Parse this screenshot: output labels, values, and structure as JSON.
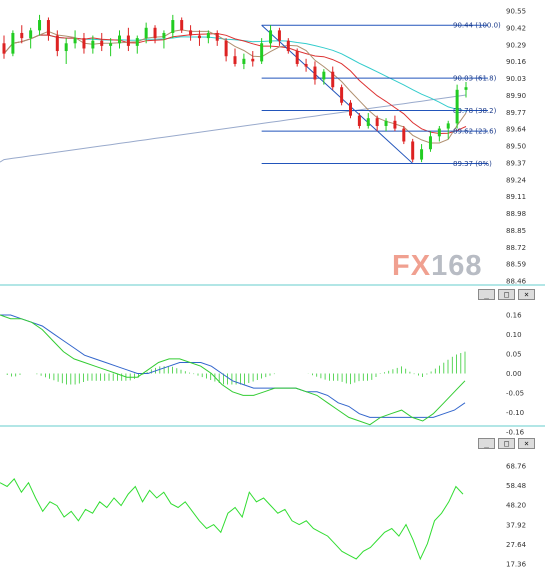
{
  "watermark": {
    "part1": "FX",
    "part2": "168"
  },
  "colors": {
    "up_candle": "#22cc22",
    "down_candle": "#dd2222",
    "fast_ma": "#b09070",
    "mid_ma": "#dd3333",
    "slow_ma": "#33cccc",
    "long_ma": "#99aacc",
    "fib_line": "#2255bb",
    "trend_line": "#2255bb",
    "macd_line": "#33cc33",
    "signal_line": "#3366cc",
    "hist": "#33cc33",
    "rsi_line": "#33dd33",
    "panel_border": "#66cccc"
  },
  "panes": {
    "macd_buttons": [
      "_",
      "□",
      "×"
    ],
    "rsi_buttons": [
      "_",
      "□",
      "×"
    ]
  },
  "chart_data": [
    {
      "type": "candlestick",
      "title": "",
      "ylim": [
        89.4,
        90.55
      ],
      "y_ticks": [
        "90.55",
        "90.42",
        "90.29",
        "90.16",
        "90.03",
        "89.90",
        "89.77",
        "89.64",
        "89.50",
        "89.37",
        "89.24",
        "89.11",
        "88.98",
        "88.85",
        "88.72",
        "88.59",
        "88.46"
      ],
      "fibonacci": [
        {
          "label": "90.44 (100.0)",
          "value": 90.44
        },
        {
          "label": "90.03 (61.8)",
          "value": 90.03
        },
        {
          "label": "89.78 (38.2)",
          "value": 89.78
        },
        {
          "label": "89.62 (23.6)",
          "value": 89.62
        },
        {
          "label": "89.37 (0%)",
          "value": 89.37
        }
      ],
      "candles": [
        [
          90.3,
          90.36,
          90.18,
          90.22
        ],
        [
          90.22,
          90.4,
          90.2,
          90.38
        ],
        [
          90.38,
          90.44,
          90.3,
          90.34
        ],
        [
          90.34,
          90.42,
          90.26,
          90.4
        ],
        [
          90.4,
          90.52,
          90.36,
          90.48
        ],
        [
          90.48,
          90.5,
          90.32,
          90.36
        ],
        [
          90.36,
          90.4,
          90.2,
          90.24
        ],
        [
          90.24,
          90.34,
          90.14,
          90.3
        ],
        [
          90.3,
          90.4,
          90.26,
          90.34
        ],
        [
          90.34,
          90.38,
          90.22,
          90.26
        ],
        [
          90.26,
          90.36,
          90.22,
          90.32
        ],
        [
          90.32,
          90.38,
          90.24,
          90.28
        ],
        [
          90.28,
          90.34,
          90.2,
          90.3
        ],
        [
          90.3,
          90.4,
          90.26,
          90.36
        ],
        [
          90.36,
          90.42,
          90.24,
          90.28
        ],
        [
          90.28,
          90.36,
          90.22,
          90.34
        ],
        [
          90.34,
          90.46,
          90.3,
          90.42
        ],
        [
          90.42,
          90.44,
          90.3,
          90.34
        ],
        [
          90.34,
          90.4,
          90.26,
          90.38
        ],
        [
          90.38,
          90.52,
          90.34,
          90.48
        ],
        [
          90.48,
          90.5,
          90.38,
          90.4
        ],
        [
          90.4,
          90.44,
          90.32,
          90.36
        ],
        [
          90.36,
          90.4,
          90.28,
          90.34
        ],
        [
          90.34,
          90.4,
          90.3,
          90.38
        ],
        [
          90.38,
          90.4,
          90.28,
          90.32
        ],
        [
          90.32,
          90.34,
          90.16,
          90.2
        ],
        [
          90.2,
          90.26,
          90.12,
          90.14
        ],
        [
          90.14,
          90.22,
          90.1,
          90.18
        ],
        [
          90.18,
          90.24,
          90.12,
          90.16
        ],
        [
          90.16,
          90.34,
          90.14,
          90.3
        ],
        [
          90.3,
          90.44,
          90.26,
          90.4
        ],
        [
          90.4,
          90.42,
          90.28,
          90.32
        ],
        [
          90.32,
          90.34,
          90.22,
          90.24
        ],
        [
          90.24,
          90.26,
          90.12,
          90.14
        ],
        [
          90.14,
          90.18,
          90.08,
          90.12
        ],
        [
          90.12,
          90.16,
          89.98,
          90.02
        ],
        [
          90.02,
          90.1,
          89.98,
          90.08
        ],
        [
          90.08,
          90.12,
          89.94,
          89.96
        ],
        [
          89.96,
          89.98,
          89.82,
          89.84
        ],
        [
          89.84,
          89.86,
          89.72,
          89.74
        ],
        [
          89.74,
          89.76,
          89.64,
          89.66
        ],
        [
          89.66,
          89.76,
          89.64,
          89.72
        ],
        [
          89.72,
          89.74,
          89.62,
          89.66
        ],
        [
          89.66,
          89.72,
          89.62,
          89.7
        ],
        [
          89.7,
          89.74,
          89.62,
          89.64
        ],
        [
          89.64,
          89.66,
          89.52,
          89.54
        ],
        [
          89.54,
          89.56,
          89.38,
          89.4
        ],
        [
          89.4,
          89.52,
          89.38,
          89.48
        ],
        [
          89.48,
          89.62,
          89.46,
          89.58
        ],
        [
          89.58,
          89.66,
          89.54,
          89.64
        ],
        [
          89.64,
          89.7,
          89.56,
          89.68
        ],
        [
          89.68,
          89.98,
          89.64,
          89.94
        ],
        [
          89.94,
          90.0,
          89.88,
          89.96
        ]
      ]
    },
    {
      "type": "line",
      "title": "",
      "ylim": [
        -0.16,
        0.16
      ],
      "y_ticks": [
        "0.16",
        "0.10",
        "0.05",
        "0.00",
        "-0.05",
        "-0.10",
        "-0.16"
      ],
      "series": [
        {
          "name": "",
          "values": [
            0.16,
            0.15,
            0.15,
            0.14,
            0.12,
            0.09,
            0.06,
            0.04,
            0.03,
            0.02,
            0.01,
            0.0,
            -0.01,
            -0.01,
            0.01,
            0.03,
            0.04,
            0.04,
            0.03,
            0.02,
            0.0,
            -0.03,
            -0.05,
            -0.06,
            -0.06,
            -0.05,
            -0.04,
            -0.04,
            -0.04,
            -0.05,
            -0.06,
            -0.08,
            -0.1,
            -0.12,
            -0.13,
            -0.14,
            -0.12,
            -0.11,
            -0.1,
            -0.12,
            -0.13,
            -0.11,
            -0.08,
            -0.05,
            -0.02
          ]
        },
        {
          "name": "",
          "values": [
            0.16,
            0.16,
            0.15,
            0.14,
            0.13,
            0.11,
            0.09,
            0.07,
            0.05,
            0.04,
            0.03,
            0.02,
            0.01,
            0.0,
            0.0,
            0.01,
            0.02,
            0.03,
            0.03,
            0.03,
            0.02,
            0.0,
            -0.02,
            -0.03,
            -0.04,
            -0.04,
            -0.04,
            -0.04,
            -0.04,
            -0.05,
            -0.05,
            -0.06,
            -0.08,
            -0.09,
            -0.11,
            -0.12,
            -0.12,
            -0.12,
            -0.12,
            -0.12,
            -0.12,
            -0.12,
            -0.11,
            -0.1,
            -0.08
          ]
        },
        {
          "name": "",
          "values": [
            0.0,
            -0.01,
            0.0,
            0.0,
            -0.01,
            -0.02,
            -0.03,
            -0.03,
            -0.02,
            -0.02,
            -0.02,
            -0.02,
            -0.02,
            -0.01,
            0.01,
            0.02,
            0.02,
            0.01,
            0.0,
            -0.01,
            -0.02,
            -0.03,
            -0.03,
            -0.03,
            -0.02,
            -0.01,
            0.0,
            0.0,
            0.0,
            0.0,
            -0.01,
            -0.02,
            -0.02,
            -0.03,
            -0.02,
            -0.02,
            0.0,
            0.01,
            0.02,
            0.0,
            -0.01,
            0.01,
            0.03,
            0.05,
            0.06
          ]
        }
      ]
    },
    {
      "type": "line",
      "title": "",
      "ylim": [
        17.36,
        68.76
      ],
      "y_ticks": [
        "68.76",
        "58.48",
        "48.20",
        "37.92",
        "27.64",
        "17.36"
      ],
      "series": [
        {
          "name": "",
          "values": [
            60,
            58,
            62,
            55,
            60,
            52,
            45,
            50,
            48,
            42,
            45,
            40,
            46,
            44,
            50,
            47,
            52,
            48,
            54,
            58,
            50,
            56,
            52,
            55,
            49,
            47,
            50,
            45,
            40,
            36,
            38,
            34,
            44,
            47,
            42,
            55,
            50,
            52,
            48,
            44,
            46,
            40,
            38,
            40,
            36,
            34,
            32,
            28,
            24,
            22,
            20,
            24,
            26,
            30,
            34,
            36,
            32,
            38,
            30,
            20,
            28,
            40,
            44,
            50,
            58,
            54
          ]
        }
      ]
    }
  ]
}
